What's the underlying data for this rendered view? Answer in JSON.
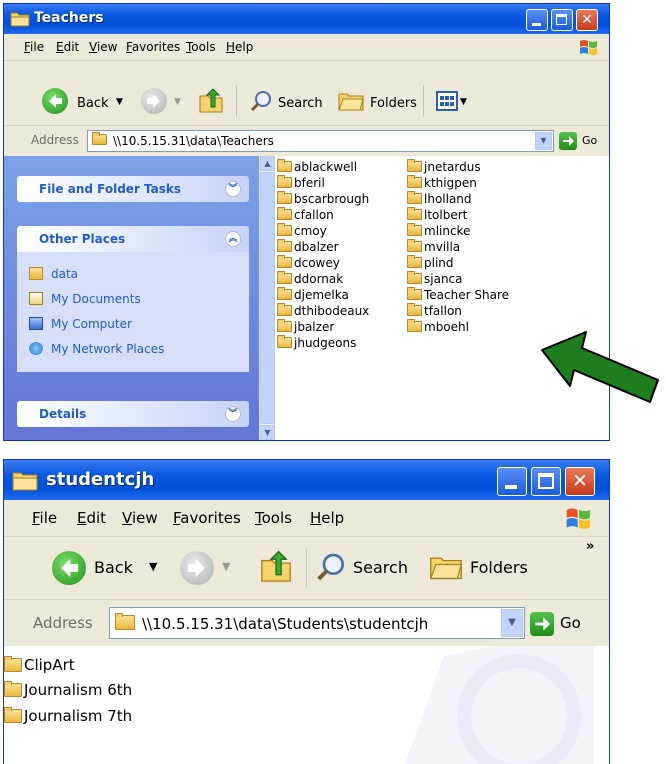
{
  "window1": {
    "title": "Teachers",
    "menu": [
      "File",
      "Edit",
      "View",
      "Favorites",
      "Tools",
      "Help"
    ],
    "toolbar": {
      "back": "Back",
      "search": "Search",
      "folders": "Folders"
    },
    "address": {
      "label": "Address",
      "path": "\\\\10.5.15.31\\data\\Teachers",
      "go": "Go"
    },
    "tasks": {
      "file_folder_tasks": "File and Folder Tasks",
      "other_places": "Other Places",
      "places": [
        "data",
        "My Documents",
        "My Computer",
        "My Network Places"
      ],
      "details": "Details"
    },
    "files_col1": [
      "ablackwell",
      "bferil",
      "bscarbrough",
      "cfallon",
      "cmoy",
      "dbalzer",
      "dcowey",
      "ddornak",
      "djemelka",
      "dthibodeaux",
      "jbalzer",
      "jhudgeons"
    ],
    "files_col2": [
      "jnetardus",
      "kthigpen",
      "lholland",
      "ltolbert",
      "mlincke",
      "mvilla",
      "plind",
      "sjanca",
      "Teacher Share",
      "tfallon",
      "mboehl"
    ]
  },
  "window2": {
    "title": "studentcjh",
    "menu": [
      "File",
      "Edit",
      "View",
      "Favorites",
      "Tools",
      "Help"
    ],
    "toolbar": {
      "back": "Back",
      "search": "Search",
      "folders": "Folders"
    },
    "address": {
      "label": "Address",
      "path": "\\\\10.5.15.31\\data\\Students\\studentcjh",
      "go": "Go"
    },
    "files": [
      "ClipArt",
      "Journalism 6th",
      "Journalism 7th"
    ]
  },
  "colors": {
    "arrow": "#1e7d1e",
    "title_blue": "#0a5ae0",
    "task_blue": "#215dc6"
  }
}
